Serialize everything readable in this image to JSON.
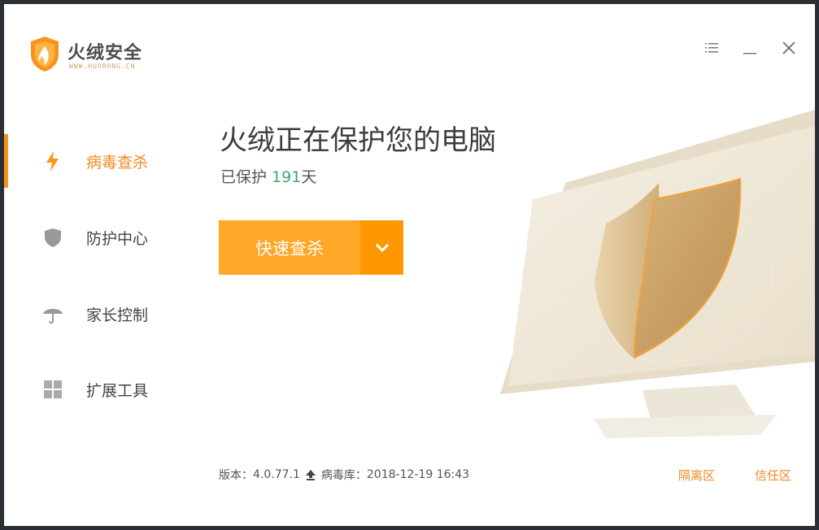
{
  "app": {
    "title": "火绒安全",
    "url": "WWW.HUORONG.CN",
    "accent": "#f7941d"
  },
  "window_controls": {
    "menu_icon": "menu-icon",
    "minimize_icon": "minimize-icon",
    "close_icon": "close-icon"
  },
  "sidebar": {
    "items": [
      {
        "label": "病毒查杀",
        "icon": "lightning-icon",
        "active": true
      },
      {
        "label": "防护中心",
        "icon": "shield-icon",
        "active": false
      },
      {
        "label": "家长控制",
        "icon": "umbrella-icon",
        "active": false
      },
      {
        "label": "扩展工具",
        "icon": "grid-icon",
        "active": false
      }
    ]
  },
  "main": {
    "headline": "火绒正在保护您的电脑",
    "protected_prefix": "已保护 ",
    "protected_days": "191",
    "protected_suffix": "天",
    "scan_button": "快速查杀",
    "dropdown_icon": "chevron-down-icon"
  },
  "footer": {
    "version_label": "版本：",
    "version": "4.0.77.1",
    "update_icon": "upload-icon",
    "virusdb_label": "病毒库：",
    "virusdb_date": "2018-12-19 16:43",
    "quarantine": "隔离区",
    "trust": "信任区"
  }
}
